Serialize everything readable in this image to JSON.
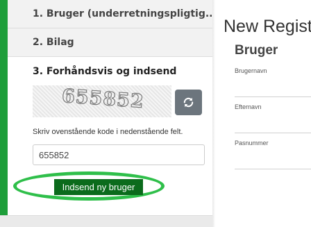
{
  "accordion": {
    "items": [
      {
        "label": "1. Bruger (underretningspligtig..."
      },
      {
        "label": "2. Bilag"
      },
      {
        "label": "3. Forhåndsvis og indsend"
      }
    ],
    "captcha_text": "655852",
    "instruction": "Skriv ovenstående kode i nedenstående felt.",
    "code_value": "655852",
    "submit_label": "Indsend ny bruger"
  },
  "form": {
    "title": "New Registr",
    "section": "Bruger",
    "fields": [
      {
        "label": "Brugernavn"
      },
      {
        "label": "Efternavn"
      },
      {
        "label": "Pasnummer"
      }
    ]
  },
  "colors": {
    "accent": "#1e9e3a",
    "submit": "#0b6b1c",
    "highlight": "#2fbf4a",
    "refresh": "#6c757d"
  }
}
